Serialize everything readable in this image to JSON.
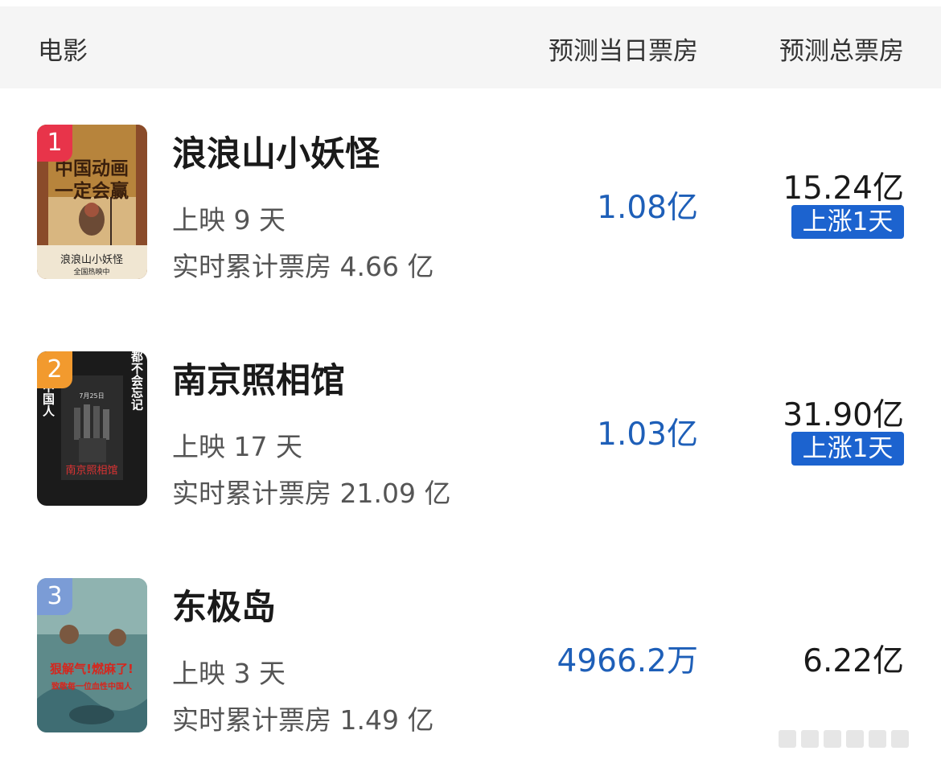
{
  "header": {
    "movie": "电影",
    "day_forecast": "预测当日票房",
    "total_forecast": "预测总票房"
  },
  "movies": [
    {
      "rank": "1",
      "rank_color": "#e8344a",
      "title": "浪浪山小妖怪",
      "days": "上映 9 天",
      "cumulative": "实时累计票房 4.66 亿",
      "day_box": "1.08亿",
      "total_box": "15.24亿",
      "badge": "上涨1天",
      "poster": {
        "headline1": "中国动画",
        "headline2": "一定会赢",
        "logo": "浪浪山小妖怪",
        "tagline": "全国热映中"
      }
    },
    {
      "rank": "2",
      "rank_color": "#f29a2e",
      "title": "南京照相馆",
      "days": "上映 17 天",
      "cumulative": "实时累计票房 21.09 亿",
      "day_box": "1.03亿",
      "total_box": "31.90亿",
      "badge": "上涨1天",
      "poster": {
        "left_text": "一个中国人",
        "right_text": "都不会忘记",
        "date": "7月25日",
        "logo": "南京照相馆"
      }
    },
    {
      "rank": "3",
      "rank_color": "#7b9cd6",
      "title": "东极岛",
      "days": "上映 3 天",
      "cumulative": "实时累计票房 1.49 亿",
      "day_box": "4966.2万",
      "total_box": "6.22亿",
      "badge": "",
      "poster": {
        "headline": "狠解气!燃麻了!",
        "subline": "致敬每一位血性中国人"
      }
    }
  ]
}
